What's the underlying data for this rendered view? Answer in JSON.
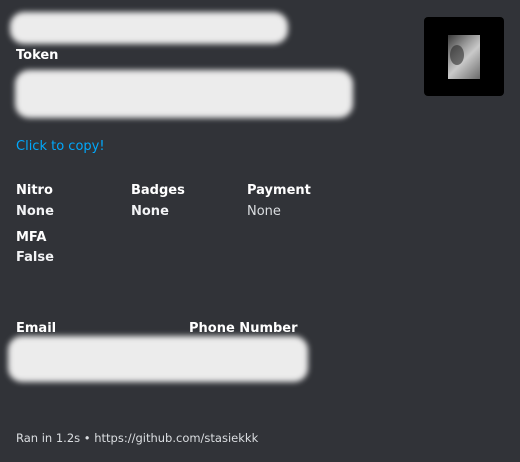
{
  "token_section": {
    "label": "Token",
    "copy_link": "Click to copy!"
  },
  "fields": {
    "nitro": {
      "label": "Nitro",
      "value": "None"
    },
    "badges": {
      "label": "Badges",
      "value": "None"
    },
    "payment": {
      "label": "Payment",
      "value": "None"
    },
    "mfa": {
      "label": "MFA",
      "value": "False"
    },
    "email": {
      "label": "Email"
    },
    "phone": {
      "label": "Phone Number"
    }
  },
  "footer": {
    "text": "Ran in 1.2s • https://github.com/stasiekkk"
  },
  "colors": {
    "background": "#313338",
    "link": "#00a8fc"
  }
}
